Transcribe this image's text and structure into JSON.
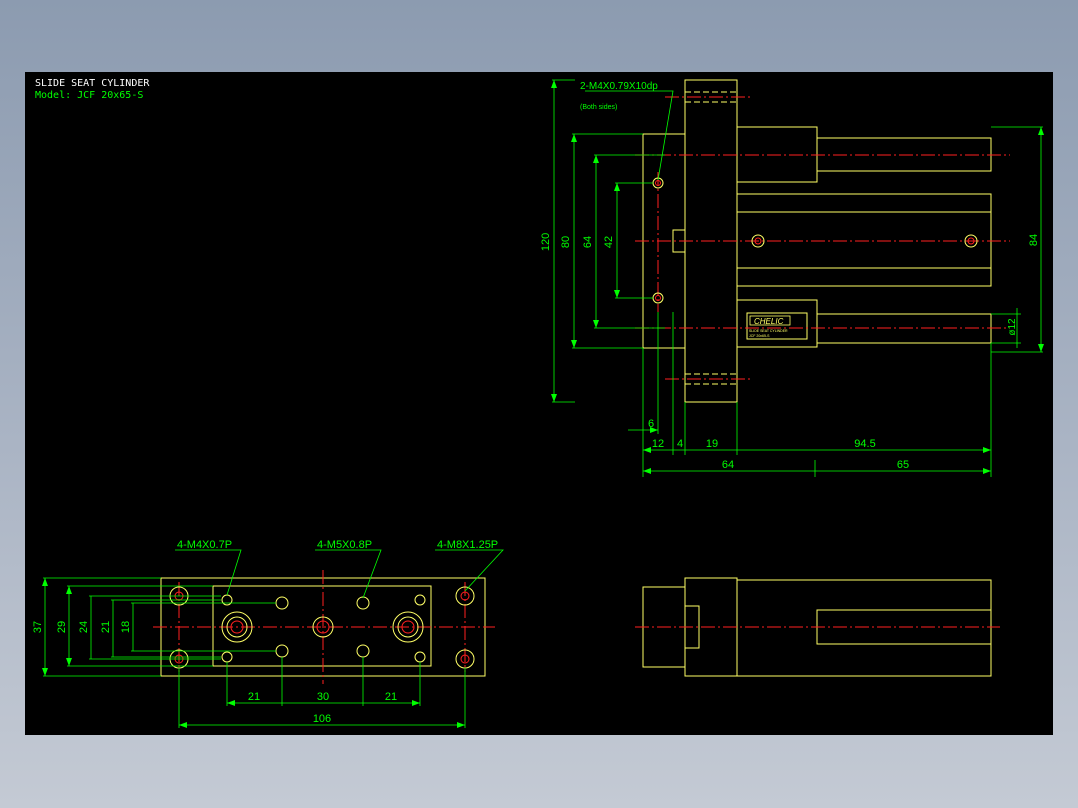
{
  "title_block": {
    "title": "SLIDE SEAT CYLINDER",
    "model": "Model: JCF 20x65-S"
  },
  "colors": {
    "background": "#000000",
    "geometry": "#ffff66",
    "dimensions": "#00ff00",
    "centerlines": "#ff2020",
    "holes": "#ff2020"
  },
  "side_view": {
    "callout": "2-M4X0.79X10dp",
    "callout_note": "(Both sides)",
    "dim_120": "120",
    "dim_80": "80",
    "dim_64": "64",
    "dim_42": "42",
    "dim_84": "84",
    "dim_dia12": "ø12",
    "dim_6": "6",
    "dim_12": "12",
    "dim_4": "4",
    "dim_19": "19",
    "dim_94_5": "94.5",
    "dim_64_bottom": "64",
    "dim_65": "65",
    "logo_text": "CHELIC",
    "label_line1": "SLIDE SEAT CYLINDER",
    "label_line2": "JCF 20x65-S"
  },
  "plan_view": {
    "callout_m4": "4-M4X0.7P",
    "callout_m5": "4-M5X0.8P",
    "callout_m8": "4-M8X1.25P",
    "dim_37": "37",
    "dim_29": "29",
    "dim_24": "24",
    "dim_21_v": "21",
    "dim_18": "18",
    "dim_21_left": "21",
    "dim_30": "30",
    "dim_21_right": "21",
    "dim_106": "106"
  }
}
